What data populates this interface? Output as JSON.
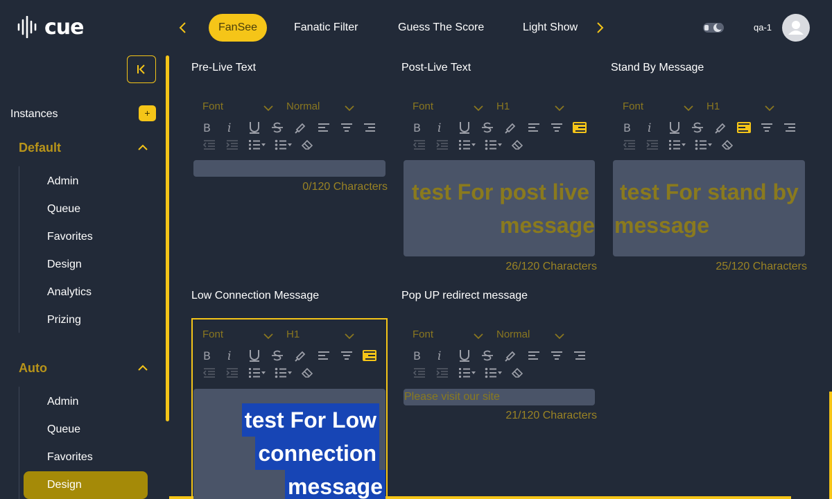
{
  "header": {
    "logo_text": "cue",
    "tabs": [
      {
        "label": "FanSee",
        "active": true
      },
      {
        "label": "Fanatic Filter",
        "active": false
      },
      {
        "label": "Guess The Score",
        "active": false
      },
      {
        "label": "Light Show",
        "active": false
      }
    ],
    "username": "qa-1"
  },
  "sidebar": {
    "instances_label": "Instances",
    "add_label": "+",
    "groups": [
      {
        "title": "Default",
        "items": [
          "Admin",
          "Queue",
          "Favorites",
          "Design",
          "Analytics",
          "Prizing"
        ]
      },
      {
        "title": "Auto",
        "items": [
          "Admin",
          "Queue",
          "Favorites",
          "Design"
        ]
      }
    ],
    "active_item": "Auto/Design"
  },
  "editors": {
    "pre_live": {
      "title": "Pre-Live Text",
      "font": "Font",
      "size": "Normal",
      "text": "",
      "count": "0/120 Characters"
    },
    "post_live": {
      "title": "Post-Live Text",
      "font": "Font",
      "size": "H1",
      "text_line1": "test For post live",
      "text_line2": "message",
      "count": "26/120 Characters"
    },
    "stand_by": {
      "title": "Stand By Message",
      "font": "Font",
      "size": "H1",
      "text_line1": "test For stand by",
      "text_line2": "message",
      "count": "25/120 Characters"
    },
    "low_connection": {
      "title": "Low Connection Message",
      "font": "Font",
      "size": "H1",
      "text_line1": "test For Low",
      "text_line2": "connection",
      "text_line3": "message"
    },
    "popup": {
      "title": "Pop UP redirect message",
      "font": "Font",
      "size": "Normal",
      "text": "Please visit our site",
      "count": "21/120 Characters"
    }
  },
  "colors": {
    "accent": "#f5c518",
    "background": "#222a38",
    "textbox": "#4a5468",
    "selection": "#1745b5"
  }
}
